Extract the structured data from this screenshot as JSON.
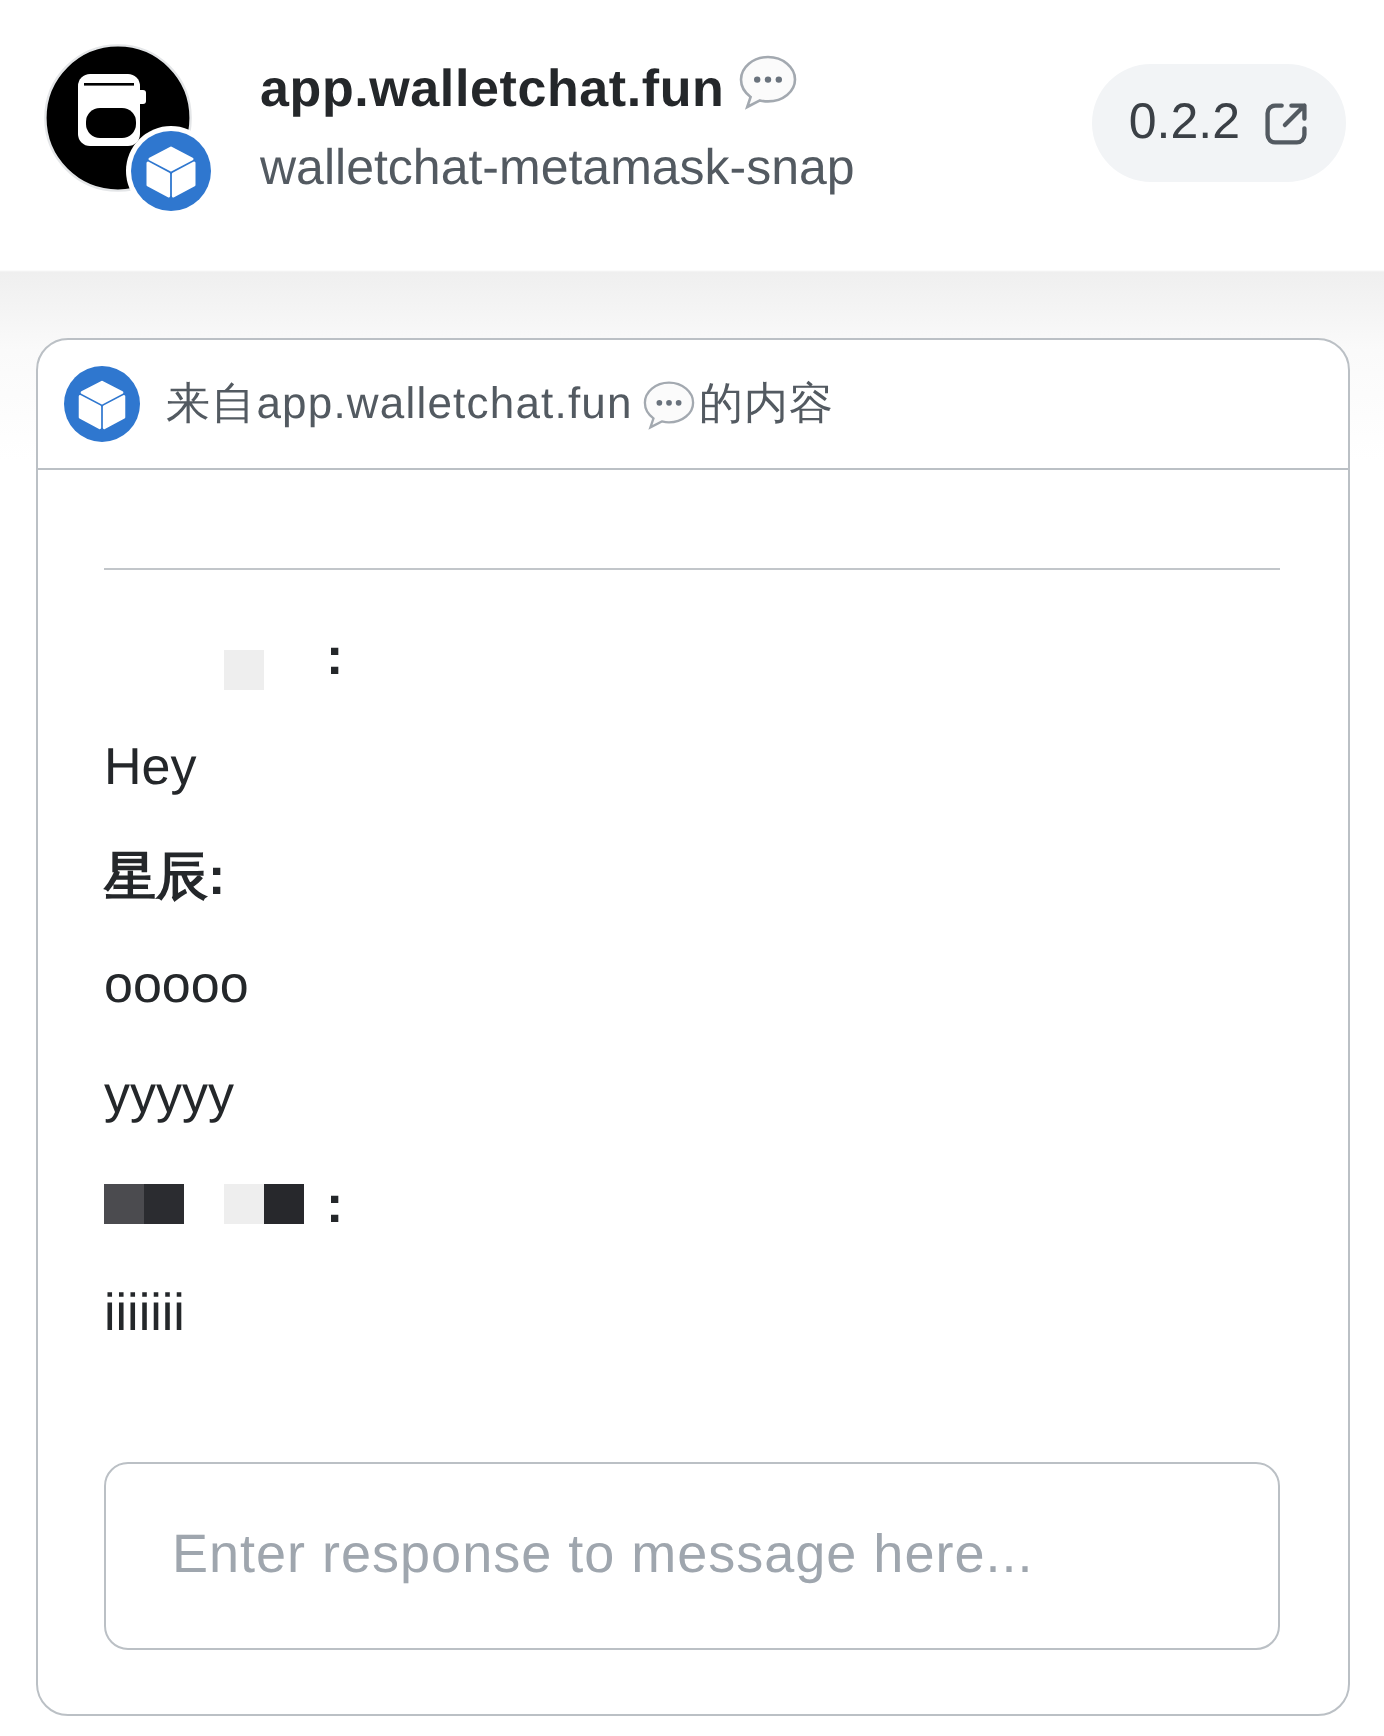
{
  "header": {
    "title": "app.walletchat.fun",
    "subtitle": "walletchat-metamask-snap",
    "version": "0.2.2"
  },
  "card": {
    "heading_parts": [
      "来自app.walletchat.fun",
      "的内容"
    ],
    "messages": [
      {
        "kind": "partly_redacted_sender",
        "text": ":"
      },
      {
        "kind": "message",
        "text": "Hey"
      },
      {
        "kind": "sender",
        "text": "星辰:"
      },
      {
        "kind": "message",
        "text": "ooooo"
      },
      {
        "kind": "message",
        "text": "yyyyy"
      },
      {
        "kind": "redacted_sender",
        "text": ":"
      },
      {
        "kind": "message",
        "text": "iiiiiii"
      }
    ],
    "response": {
      "placeholder": "Enter response to message here..."
    }
  }
}
